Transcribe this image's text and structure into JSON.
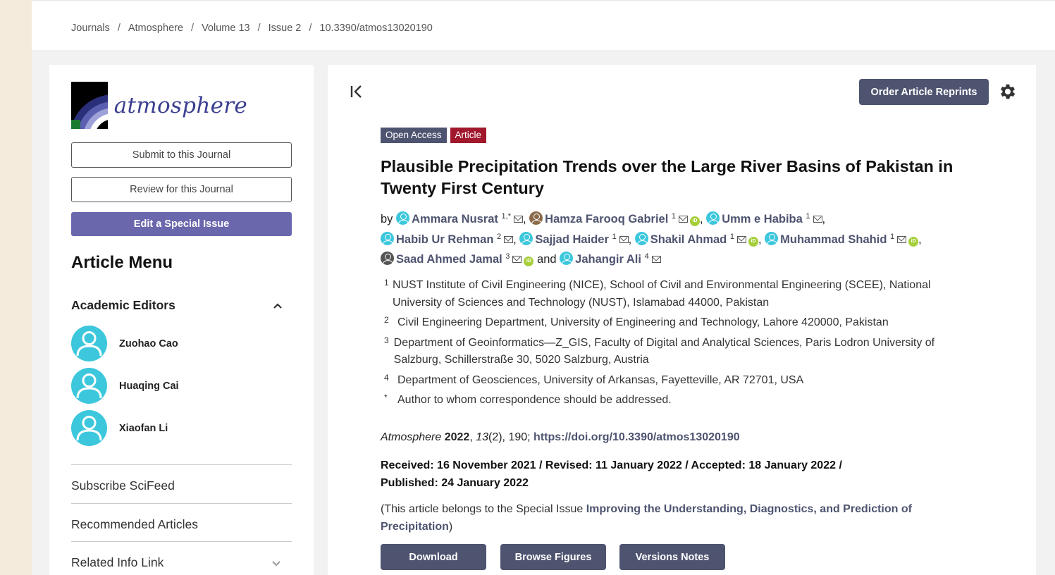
{
  "breadcrumb": [
    "Journals",
    "Atmosphere",
    "Volume 13",
    "Issue 2",
    "10.3390/atmos13020190"
  ],
  "sidebar": {
    "logo_text": "atmosphere",
    "submit_label": "Submit to this Journal",
    "review_label": "Review for this Journal",
    "special_label": "Edit a Special Issue",
    "article_menu_label": "Article Menu",
    "academic_editors_label": "Academic Editors",
    "editors": [
      "Zuohao Cao",
      "Huaqing Cai",
      "Xiaofan Li"
    ],
    "links": [
      "Subscribe SciFeed",
      "Recommended Articles",
      "Related Info Link"
    ]
  },
  "main": {
    "reprint_label": "Order Article Reprints",
    "badge_oa": "Open Access",
    "badge_article": "Article",
    "title": "Plausible Precipitation Trends over the Large River Basins of Pakistan in Twenty First Century",
    "by": "by",
    "authors": [
      {
        "name": "Ammara Nusrat",
        "sup": "1,*"
      },
      {
        "name": "Hamza Farooq Gabriel",
        "sup": "1"
      },
      {
        "name": "Umm e Habiba",
        "sup": "1"
      },
      {
        "name": "Habib Ur Rehman",
        "sup": "2"
      },
      {
        "name": "Sajjad Haider",
        "sup": "1"
      },
      {
        "name": "Shakil Ahmad",
        "sup": "1"
      },
      {
        "name": "Muhammad Shahid",
        "sup": "1"
      },
      {
        "name": "Saad Ahmed Jamal",
        "sup": "3"
      },
      {
        "name": "Jahangir Ali",
        "sup": "4"
      }
    ],
    "and": "and",
    "affiliations": [
      {
        "num": "1",
        "text": "NUST Institute of Civil Engineering (NICE), School of Civil and Environmental Engineering (SCEE), National University of Sciences and Technology (NUST), Islamabad 44000, Pakistan"
      },
      {
        "num": "2",
        "text": "Civil Engineering Department, University of Engineering and Technology, Lahore 420000, Pakistan"
      },
      {
        "num": "3",
        "text": "Department of Geoinformatics—Z_GIS, Faculty of Digital and Analytical Sciences, Paris Lodron University of Salzburg, Schillerstraße 30, 5020 Salzburg, Austria"
      },
      {
        "num": "4",
        "text": "Department of Geosciences, University of Arkansas, Fayetteville, AR 72701, USA"
      },
      {
        "num": "*",
        "text": "Author to whom correspondence should be addressed."
      }
    ],
    "citation": {
      "journal": "Atmosphere",
      "year": "2022",
      "volume": "13",
      "issue_pages": "(2), 190;",
      "doi": "https://doi.org/10.3390/atmos13020190"
    },
    "dates_line1": "Received: 16 November 2021 / Revised: 11 January 2022 / Accepted: 18 January 2022 /",
    "dates_line2": "Published: 24 January 2022",
    "special_prefix": "(This article belongs to the Special Issue ",
    "special_title": "Improving the Understanding, Diagnostics, and Prediction of Precipitation",
    "special_suffix": ")",
    "download_label": "Download",
    "figures_label": "Browse Figures",
    "versions_label": "Versions Notes"
  }
}
